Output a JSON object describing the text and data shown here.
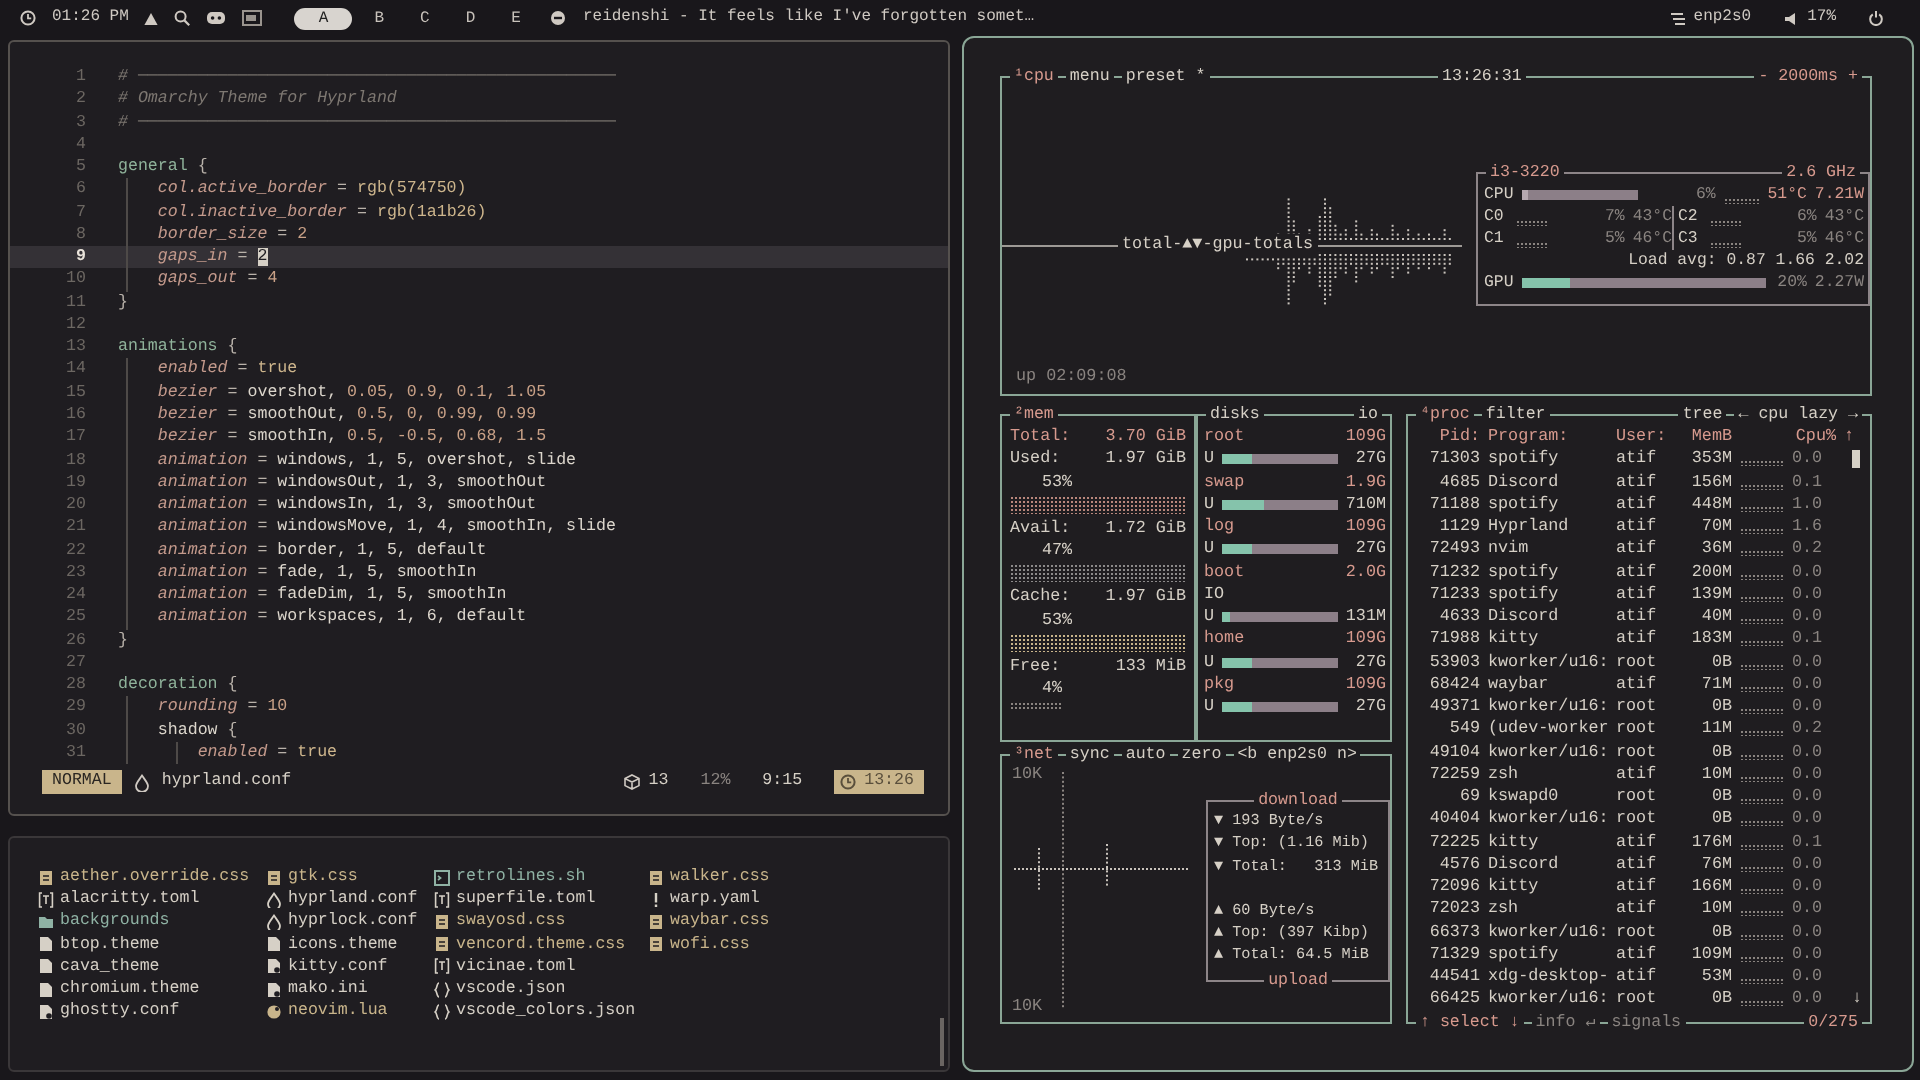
{
  "top_bar": {
    "clock": "01:26 PM",
    "workspaces": [
      {
        "label": "A",
        "selected": true
      },
      {
        "label": "B",
        "selected": false
      },
      {
        "label": "C",
        "selected": false
      },
      {
        "label": "D",
        "selected": false
      },
      {
        "label": "E",
        "selected": false
      }
    ],
    "window_title": "reidenshi - It feels like I've forgotten somet…",
    "network": "enp2s0",
    "volume": "17%"
  },
  "editor": {
    "lines": [
      {
        "num": "1",
        "current": false,
        "parts": [
          {
            "kind": "comment",
            "text": "# ────────────────────────────────────────────────"
          }
        ]
      },
      {
        "num": "2",
        "current": false,
        "parts": [
          {
            "kind": "comment",
            "text": "# Omarchy Theme for Hyprland"
          }
        ]
      },
      {
        "num": "3",
        "current": false,
        "parts": [
          {
            "kind": "comment",
            "text": "# ────────────────────────────────────────────────"
          }
        ]
      },
      {
        "num": "4",
        "current": false
      },
      {
        "num": "5",
        "current": false,
        "parts": [
          {
            "kind": "section",
            "text": "general"
          },
          {
            "kind": "punct",
            "text": " {"
          }
        ]
      },
      {
        "num": "6",
        "current": false,
        "parts": [
          {
            "kind": "prop",
            "text": "    col.active_border"
          },
          {
            "kind": "punct",
            "text": " = "
          },
          {
            "kind": "func",
            "text": "rgb(574750)"
          }
        ]
      },
      {
        "num": "7",
        "current": false,
        "parts": [
          {
            "kind": "prop",
            "text": "    col.inactive_border"
          },
          {
            "kind": "punct",
            "text": " = "
          },
          {
            "kind": "func",
            "text": "rgb(1a1b26)"
          }
        ]
      },
      {
        "num": "8",
        "current": false,
        "parts": [
          {
            "kind": "prop",
            "text": "    border_size"
          },
          {
            "kind": "punct",
            "text": " = "
          },
          {
            "kind": "num",
            "text": "2"
          }
        ]
      },
      {
        "num": "9",
        "current": true,
        "parts": [
          {
            "kind": "prop",
            "text": "    gaps_in"
          },
          {
            "kind": "punct",
            "text": " = "
          },
          {
            "kind": "cursor",
            "text": "2"
          }
        ]
      },
      {
        "num": "10",
        "current": false,
        "parts": [
          {
            "kind": "prop",
            "text": "    gaps_out"
          },
          {
            "kind": "punct",
            "text": " = "
          },
          {
            "kind": "num",
            "text": "4"
          }
        ]
      },
      {
        "num": "11",
        "current": false,
        "parts": [
          {
            "kind": "punct",
            "text": "}"
          }
        ]
      },
      {
        "num": "12",
        "current": false
      },
      {
        "num": "13",
        "current": false,
        "parts": [
          {
            "kind": "section",
            "text": "animations"
          },
          {
            "kind": "punct",
            "text": " {"
          }
        ]
      },
      {
        "num": "14",
        "current": false,
        "parts": [
          {
            "kind": "prop",
            "text": "    enabled"
          },
          {
            "kind": "punct",
            "text": " = "
          },
          {
            "kind": "func",
            "text": "true"
          }
        ]
      },
      {
        "num": "15",
        "current": false,
        "parts": [
          {
            "kind": "prop",
            "text": "    bezier"
          },
          {
            "kind": "punct",
            "text": " = "
          },
          {
            "kind": "word",
            "text": "overshot, "
          },
          {
            "kind": "num",
            "text": "0.05, 0.9, 0.1, 1.05"
          }
        ]
      },
      {
        "num": "16",
        "current": false,
        "parts": [
          {
            "kind": "prop",
            "text": "    bezier"
          },
          {
            "kind": "punct",
            "text": " = "
          },
          {
            "kind": "word",
            "text": "smoothOut, "
          },
          {
            "kind": "num",
            "text": "0.5, 0, 0.99, 0.99"
          }
        ]
      },
      {
        "num": "17",
        "current": false,
        "parts": [
          {
            "kind": "prop",
            "text": "    bezier"
          },
          {
            "kind": "punct",
            "text": " = "
          },
          {
            "kind": "word",
            "text": "smoothIn, "
          },
          {
            "kind": "num",
            "text": "0.5, -0.5, 0.68, 1.5"
          }
        ]
      },
      {
        "num": "18",
        "current": false,
        "parts": [
          {
            "kind": "prop",
            "text": "    animation"
          },
          {
            "kind": "punct",
            "text": " = "
          },
          {
            "kind": "word",
            "text": "windows, 1, 5, overshot, slide"
          }
        ]
      },
      {
        "num": "19",
        "current": false,
        "parts": [
          {
            "kind": "prop",
            "text": "    animation"
          },
          {
            "kind": "punct",
            "text": " = "
          },
          {
            "kind": "word",
            "text": "windowsOut, 1, 3, smoothOut"
          }
        ]
      },
      {
        "num": "20",
        "current": false,
        "parts": [
          {
            "kind": "prop",
            "text": "    animation"
          },
          {
            "kind": "punct",
            "text": " = "
          },
          {
            "kind": "word",
            "text": "windowsIn, 1, 3, smoothOut"
          }
        ]
      },
      {
        "num": "21",
        "current": false,
        "parts": [
          {
            "kind": "prop",
            "text": "    animation"
          },
          {
            "kind": "punct",
            "text": " = "
          },
          {
            "kind": "word",
            "text": "windowsMove, 1, 4, smoothIn, slide"
          }
        ]
      },
      {
        "num": "22",
        "current": false,
        "parts": [
          {
            "kind": "prop",
            "text": "    animation"
          },
          {
            "kind": "punct",
            "text": " = "
          },
          {
            "kind": "word",
            "text": "border, 1, 5, default"
          }
        ]
      },
      {
        "num": "23",
        "current": false,
        "parts": [
          {
            "kind": "prop",
            "text": "    animation"
          },
          {
            "kind": "punct",
            "text": " = "
          },
          {
            "kind": "word",
            "text": "fade, 1, 5, smoothIn"
          }
        ]
      },
      {
        "num": "24",
        "current": false,
        "parts": [
          {
            "kind": "prop",
            "text": "    animation"
          },
          {
            "kind": "punct",
            "text": " = "
          },
          {
            "kind": "word",
            "text": "fadeDim, 1, 5, smoothIn"
          }
        ]
      },
      {
        "num": "25",
        "current": false,
        "parts": [
          {
            "kind": "prop",
            "text": "    animation"
          },
          {
            "kind": "punct",
            "text": " = "
          },
          {
            "kind": "word",
            "text": "workspaces, 1, 6, default"
          }
        ]
      },
      {
        "num": "26",
        "current": false,
        "parts": [
          {
            "kind": "punct",
            "text": "}"
          }
        ]
      },
      {
        "num": "27",
        "current": false
      },
      {
        "num": "28",
        "current": false,
        "parts": [
          {
            "kind": "section",
            "text": "decoration"
          },
          {
            "kind": "punct",
            "text": " {"
          }
        ]
      },
      {
        "num": "29",
        "current": false,
        "parts": [
          {
            "kind": "prop",
            "text": "    rounding"
          },
          {
            "kind": "punct",
            "text": " = "
          },
          {
            "kind": "num",
            "text": "10"
          }
        ]
      },
      {
        "num": "30",
        "current": false,
        "parts": [
          {
            "kind": "word",
            "text": "    shadow"
          },
          {
            "kind": "punct",
            "text": " {"
          }
        ]
      },
      {
        "num": "31",
        "current": false,
        "parts": [
          {
            "kind": "prop",
            "text": "        enabled"
          },
          {
            "kind": "punct",
            "text": " = "
          },
          {
            "kind": "func",
            "text": "true"
          }
        ]
      }
    ],
    "status": {
      "mode": "NORMAL",
      "file": "hyprland.conf",
      "count": "13",
      "percent": "12%",
      "position": "9:15",
      "time": "13:26"
    }
  },
  "files": {
    "columns": [
      [
        {
          "name": "aether.override.css",
          "kind": "css"
        },
        {
          "name": "alacritty.toml",
          "kind": "toml"
        },
        {
          "name": "backgrounds",
          "kind": "folder"
        },
        {
          "name": "btop.theme",
          "kind": "file"
        },
        {
          "name": "cava_theme",
          "kind": "file"
        },
        {
          "name": "chromium.theme",
          "kind": "file"
        },
        {
          "name": "ghostty.conf",
          "kind": "config"
        }
      ],
      [
        {
          "name": "gtk.css",
          "kind": "css"
        },
        {
          "name": "hyprland.conf",
          "kind": "hypr"
        },
        {
          "name": "hyprlock.conf",
          "kind": "hypr"
        },
        {
          "name": "icons.theme",
          "kind": "file"
        },
        {
          "name": "kitty.conf",
          "kind": "config"
        },
        {
          "name": "mako.ini",
          "kind": "config"
        },
        {
          "name": "neovim.lua",
          "kind": "lua"
        }
      ],
      [
        {
          "name": "retrolines.sh",
          "kind": "shell"
        },
        {
          "name": "superfile.toml",
          "kind": "toml"
        },
        {
          "name": "swayosd.css",
          "kind": "css"
        },
        {
          "name": "vencord.theme.css",
          "kind": "css"
        },
        {
          "name": "vicinae.toml",
          "kind": "toml"
        },
        {
          "name": "vscode.json",
          "kind": "json"
        },
        {
          "name": "vscode_colors.json",
          "kind": "json"
        }
      ],
      [
        {
          "name": "walker.css",
          "kind": "css"
        },
        {
          "name": "warp.yaml",
          "kind": "yaml"
        },
        {
          "name": "waybar.css",
          "kind": "css"
        },
        {
          "name": "wofi.css",
          "kind": "css"
        }
      ]
    ]
  },
  "btop": {
    "cpu": {
      "tabs": [
        "¹cpu",
        "menu",
        "preset *"
      ],
      "clock": "13:26:31",
      "interval": "- 2000ms +",
      "graph_label": "total-▲▼-gpu-totals",
      "uptime": "up 02:09:08",
      "model": "i3-3220",
      "freq": "2.6 GHz",
      "cpu_label": "CPU",
      "cpu_bar": {
        "level": 0.06
      },
      "cpu_percent": "6%",
      "cpu_temp": "51°C",
      "cpu_power": "7.21W",
      "cores": [
        {
          "name": "C0",
          "percent": "7%",
          "temp": "43°C"
        },
        {
          "name": "C2",
          "percent": "6%",
          "temp": "43°C"
        },
        {
          "name": "C1",
          "percent": "5%",
          "temp": "46°C"
        },
        {
          "name": "C3",
          "percent": "5%",
          "temp": "46°C"
        }
      ],
      "load": "Load avg: 0.87 1.66 2.02",
      "gpu_label": "GPU",
      "gpu_bar": {
        "level": 0.2
      },
      "gpu_percent": "20%",
      "gpu_power": "2.27W"
    },
    "mem": {
      "title": "²mem",
      "rows": [
        {
          "label": "Total:",
          "value": "3.70 GiB"
        },
        {
          "label": "Used:",
          "value": "1.97 GiB",
          "percent": "53%"
        },
        {
          "label": "Avail:",
          "value": "1.72 GiB",
          "percent": "47%"
        },
        {
          "label": "Cache:",
          "value": "1.97 GiB",
          "percent": "53%"
        },
        {
          "label": "Free:",
          "value": "133 MiB",
          "percent": "4%"
        }
      ]
    },
    "disks": {
      "title": "disks",
      "io": "io",
      "items": [
        {
          "name": "root",
          "size": "109G",
          "used_label": "U",
          "used": "27G",
          "level": 0.25
        },
        {
          "name": "swap",
          "size": "1.9G",
          "used_label": "U",
          "used": "710M",
          "level": 0.37
        },
        {
          "name": "log",
          "size": "109G",
          "used_label": "U",
          "used": "27G",
          "level": 0.25
        },
        {
          "name": "boot",
          "size": "2.0G",
          "io_label": "IO",
          "used_label": "U",
          "used": "131M",
          "level": 0.06
        },
        {
          "name": "home",
          "size": "109G",
          "used_label": "U",
          "used": "27G",
          "level": 0.25
        },
        {
          "name": "pkg",
          "size": "109G",
          "used_label": "U",
          "used": "27G",
          "level": 0.25
        }
      ]
    },
    "net": {
      "tabs": [
        "³net",
        "sync",
        "auto",
        "zero",
        "<b enp2s0 n>"
      ],
      "scale_top": "10K",
      "scale_bottom": "10K",
      "download_title": "download",
      "upload_title": "upload",
      "download": [
        "▼ 193 Byte/s",
        "▼ Top: (1.16 Mib)",
        "▼ Total:   313 MiB"
      ],
      "upload": [
        "▲ 60 Byte/s",
        "▲ Top: (397 Kibp)",
        "▲ Total: 64.5 MiB"
      ]
    },
    "proc": {
      "tabs": [
        "⁴proc",
        "filter"
      ],
      "right_tabs": [
        "tree",
        "← cpu lazy →"
      ],
      "columns": [
        "Pid:",
        "Program:",
        "User:",
        "MemB",
        "Cpu%"
      ],
      "sort_arrow": "↑",
      "scroll_arrow": "↓",
      "rows": [
        {
          "pid": "71303",
          "program": "spotify",
          "user": "atif",
          "mem": "353M",
          "cpu": "0.0"
        },
        {
          "pid": "4685",
          "program": "Discord",
          "user": "atif",
          "mem": "156M",
          "cpu": "0.1"
        },
        {
          "pid": "71188",
          "program": "spotify",
          "user": "atif",
          "mem": "448M",
          "cpu": "1.0"
        },
        {
          "pid": "1129",
          "program": "Hyprland",
          "user": "atif",
          "mem": "70M",
          "cpu": "1.6"
        },
        {
          "pid": "72493",
          "program": "nvim",
          "user": "atif",
          "mem": "36M",
          "cpu": "0.2"
        },
        {
          "pid": "71232",
          "program": "spotify",
          "user": "atif",
          "mem": "200M",
          "cpu": "0.0"
        },
        {
          "pid": "71233",
          "program": "spotify",
          "user": "atif",
          "mem": "139M",
          "cpu": "0.0"
        },
        {
          "pid": "4633",
          "program": "Discord",
          "user": "atif",
          "mem": "40M",
          "cpu": "0.0"
        },
        {
          "pid": "71988",
          "program": "kitty",
          "user": "atif",
          "mem": "183M",
          "cpu": "0.1"
        },
        {
          "pid": "53903",
          "program": "kworker/u16:",
          "user": "root",
          "mem": "0B",
          "cpu": "0.0"
        },
        {
          "pid": "68424",
          "program": "waybar",
          "user": "atif",
          "mem": "71M",
          "cpu": "0.0"
        },
        {
          "pid": "49371",
          "program": "kworker/u16:",
          "user": "root",
          "mem": "0B",
          "cpu": "0.0"
        },
        {
          "pid": "549",
          "program": "(udev-worker",
          "user": "root",
          "mem": "11M",
          "cpu": "0.2"
        },
        {
          "pid": "49104",
          "program": "kworker/u16:",
          "user": "root",
          "mem": "0B",
          "cpu": "0.0"
        },
        {
          "pid": "72259",
          "program": "zsh",
          "user": "atif",
          "mem": "10M",
          "cpu": "0.0"
        },
        {
          "pid": "69",
          "program": "kswapd0",
          "user": "root",
          "mem": "0B",
          "cpu": "0.0"
        },
        {
          "pid": "40404",
          "program": "kworker/u16:",
          "user": "root",
          "mem": "0B",
          "cpu": "0.0"
        },
        {
          "pid": "72225",
          "program": "kitty",
          "user": "atif",
          "mem": "176M",
          "cpu": "0.1"
        },
        {
          "pid": "4576",
          "program": "Discord",
          "user": "atif",
          "mem": "76M",
          "cpu": "0.0"
        },
        {
          "pid": "72096",
          "program": "kitty",
          "user": "atif",
          "mem": "166M",
          "cpu": "0.0"
        },
        {
          "pid": "72023",
          "program": "zsh",
          "user": "atif",
          "mem": "10M",
          "cpu": "0.0"
        },
        {
          "pid": "66373",
          "program": "kworker/u16:",
          "user": "root",
          "mem": "0B",
          "cpu": "0.0"
        },
        {
          "pid": "71329",
          "program": "spotify",
          "user": "atif",
          "mem": "109M",
          "cpu": "0.0"
        },
        {
          "pid": "44541",
          "program": "xdg-desktop-",
          "user": "atif",
          "mem": "53M",
          "cpu": "0.0"
        },
        {
          "pid": "66425",
          "program": "kworker/u16:",
          "user": "root",
          "mem": "0B",
          "cpu": "0.0"
        }
      ],
      "footer": [
        "↑ select ↓",
        "info ↵",
        "signals"
      ],
      "count": "0/275"
    }
  }
}
